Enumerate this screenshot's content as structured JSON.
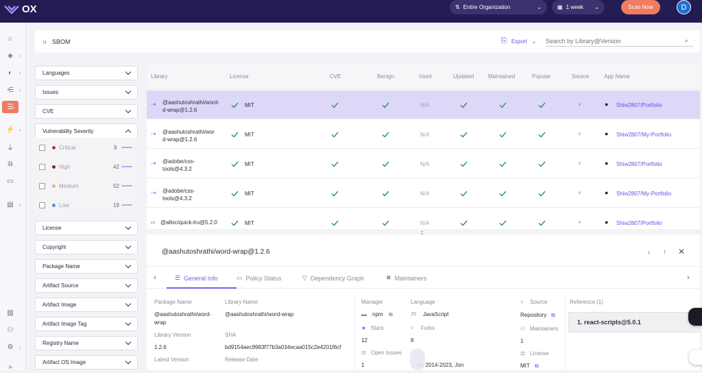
{
  "topbar": {
    "logo": "OX",
    "org_selector": "Entire Organization",
    "period_selector": "1 week",
    "scan_button": "Scan Now",
    "avatar_initial": "D"
  },
  "header": {
    "title": "SBOM",
    "export_label": "Export",
    "search_placeholder": "Search by Library@Version"
  },
  "filters": {
    "languages": "Languages",
    "issues": "Issues",
    "cve": "CVE",
    "vuln_severity": "Vulnerability Severity",
    "severity": [
      {
        "label": "Critical",
        "count": "9",
        "color": "#b33b3b"
      },
      {
        "label": "High",
        "count": "42",
        "color": "#7a2a2a"
      },
      {
        "label": "Medium",
        "count": "52",
        "color": "#f0b35e"
      },
      {
        "label": "Low",
        "count": "19",
        "color": "#5a8ee8"
      }
    ],
    "license": "License",
    "copyright": "Copyright",
    "package_name": "Package Name",
    "artifact_source": "Artifact Source",
    "artifact_image": "Artifact Image",
    "artifact_image_tag": "Artifact Image Tag",
    "registry_name": "Registry Name",
    "artifact_os_image": "Artifact OS Image"
  },
  "table": {
    "columns": [
      "Library",
      "License",
      "CVE",
      "Benign",
      "Used",
      "Updated",
      "Maintained",
      "Popular",
      "Source",
      "App Name"
    ],
    "rows": [
      {
        "lib1": "@aashutoshrathi/word-",
        "lib2": "d-wrap@1.2.6",
        "license": "MIT",
        "used": "N/A",
        "app": "Shiw2807/Portfolio"
      },
      {
        "lib1": "@aashutoshrathi/wor",
        "lib2": "d-wrap@1.2.6",
        "license": "MIT",
        "used": "N/A",
        "app": "Shiw2807/My-Portfolio"
      },
      {
        "lib1": "@adobe/css-",
        "lib2": "tools@4.3.2",
        "license": "MIT",
        "used": "N/A",
        "app": "Shiw2807/Portfolio"
      },
      {
        "lib1": "@adobe/css-",
        "lib2": "tools@4.3.2",
        "license": "MIT",
        "used": "N/A",
        "app": "Shiw2807/My-Portfolio"
      },
      {
        "lib1": "@alloc/quick-lru@5.2.0",
        "lib2": "",
        "license": "MIT",
        "used": "N/A",
        "app": "Shiw2807/Portfolio"
      }
    ]
  },
  "panel": {
    "title": "@aashutoshrathi/word-wrap@1.2.6",
    "tabs": [
      "General Info",
      "Policy Status",
      "Dependency Graph",
      "Maintainers"
    ],
    "package_name_label": "Package Name",
    "package_name_1": "@aashutoshrathi/word-",
    "package_name_2": "wrap",
    "library_name_label": "Library Name",
    "library_name": "@aashutoshrathi/word-wrap",
    "library_version_label": "Library Version",
    "library_version": "1.2.6",
    "sha_label": "SHA",
    "sha": "bd9154aec9983f77b3a034ecaa015c2e4201f6cf",
    "latest_version_label": "Latest Version",
    "release_date_label": "Release Date",
    "manager_label": "Manager",
    "manager": "npm",
    "language_label": "Language",
    "language": "JavaScript",
    "stars_label": "Stars",
    "stars": "12",
    "forks_label": "Forks",
    "forks": "8",
    "open_issues_label": "Open Issues",
    "open_issues": "1",
    "copyright_text": "(c) 2014-2023, Jon",
    "source_label": "Source",
    "source": "Repository",
    "maintainers_label": "Maintainers",
    "maintainers": "1",
    "license_label": "License",
    "license": "MIT",
    "reference_label": "Reference (1)",
    "reference_item": "1.  react-scripts@5.0.1"
  }
}
